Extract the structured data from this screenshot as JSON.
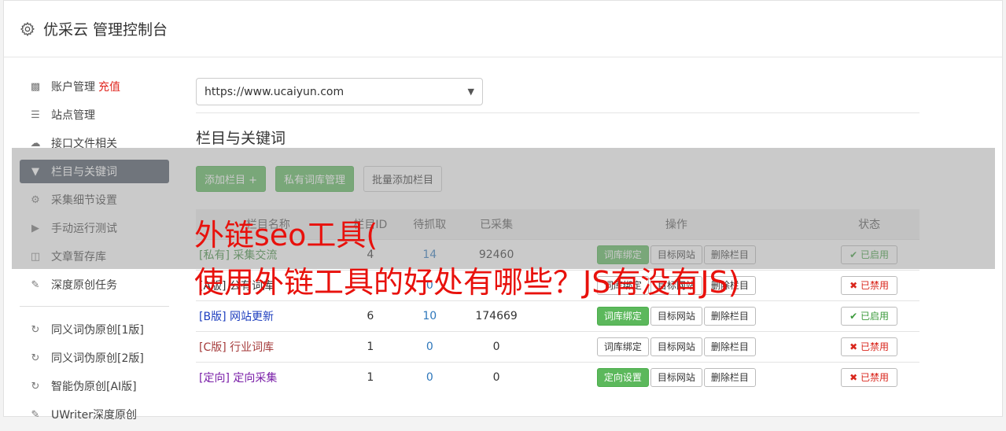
{
  "header": {
    "title": "优采云 管理控制台"
  },
  "sidebar": {
    "items": [
      {
        "label": "账户管理",
        "extra": "充值",
        "icon": "bar-chart-icon"
      },
      {
        "label": "站点管理",
        "icon": "server-icon"
      },
      {
        "label": "接口文件相关",
        "icon": "cloud-upload-icon"
      },
      {
        "label": "栏目与关键词",
        "icon": "filter-icon",
        "active": true
      },
      {
        "label": "采集细节设置",
        "icon": "gears-icon"
      },
      {
        "label": "手动运行测试",
        "icon": "play-circle-icon"
      },
      {
        "label": "文章暂存库",
        "icon": "database-icon"
      },
      {
        "label": "深度原创任务",
        "icon": "edit-icon"
      }
    ],
    "items2": [
      {
        "label": "同义词伪原创[1版]",
        "icon": "refresh-icon"
      },
      {
        "label": "同义词伪原创[2版]",
        "icon": "refresh-icon"
      },
      {
        "label": "智能伪原创[AI版]",
        "icon": "refresh-icon"
      },
      {
        "label": "UWriter深度原创",
        "icon": "edit-icon"
      }
    ]
  },
  "main": {
    "site_select": "https://www.ucaiyun.com",
    "section_title": "栏目与关键词",
    "toolbar": {
      "add": "添加栏目 +",
      "private_lib": "私有词库管理",
      "batch_add": "批量添加栏目"
    },
    "table": {
      "headers": [
        "栏目名称",
        "栏目ID",
        "待抓取",
        "已采集",
        "操作",
        "状态"
      ],
      "rows": [
        {
          "name": "[私有] 采集交流",
          "id": "4",
          "pending": "14",
          "collected": "92460",
          "op1": "词库绑定",
          "op1_active": true,
          "op2": "目标网站",
          "op3": "删除栏目",
          "status": "已启用",
          "enabled": true,
          "color": "#3c8a3c"
        },
        {
          "name": "[A版] 公有词库",
          "id": "",
          "pending": "0",
          "collected": "",
          "op1": "词库绑定",
          "op1_active": false,
          "op2": "目标网站",
          "op3": "删除栏目",
          "status": "已禁用",
          "enabled": false,
          "color": "#333333"
        },
        {
          "name": "[B版] 网站更新",
          "id": "6",
          "pending": "10",
          "collected": "174669",
          "op1": "词库绑定",
          "op1_active": true,
          "op2": "目标网站",
          "op3": "删除栏目",
          "status": "已启用",
          "enabled": true,
          "color": "#1f3fbf"
        },
        {
          "name": "[C版] 行业词库",
          "id": "1",
          "pending": "0",
          "collected": "0",
          "op1": "词库绑定",
          "op1_active": false,
          "op2": "目标网站",
          "op3": "删除栏目",
          "status": "已禁用",
          "enabled": false,
          "color": "#a53b3b"
        },
        {
          "name": "[定向] 定向采集",
          "id": "1",
          "pending": "0",
          "collected": "0",
          "op1": "定向设置",
          "op1_active": true,
          "op2": "目标网站",
          "op3": "删除栏目",
          "status": "已禁用",
          "enabled": false,
          "color": "#7a1fa8"
        }
      ]
    }
  },
  "watermark": {
    "line1": "外链seo工具(",
    "line2": "使用外链工具的好处有哪些？JS有没有JS)"
  }
}
